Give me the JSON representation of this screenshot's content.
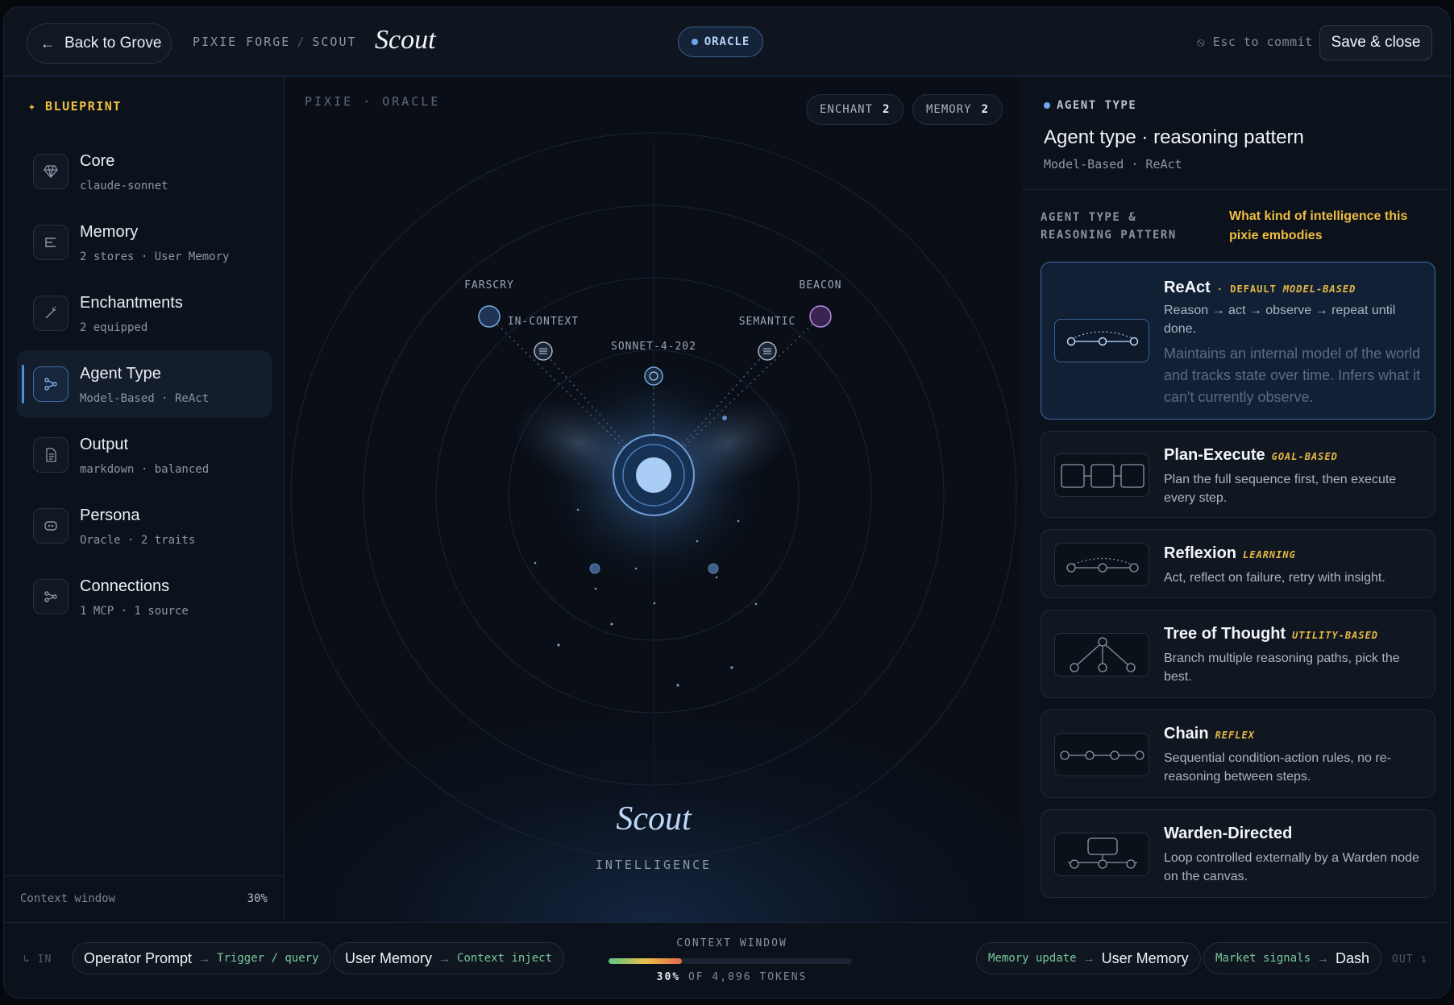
{
  "header": {
    "back_label": "Back to Grove",
    "crumb_1": "PIXIE FORGE",
    "crumb_sep": "/",
    "crumb_2": "SCOUT",
    "title": "Scout",
    "mode_pill": "ORACLE",
    "esc_hint": "⦸ Esc to commit",
    "save_label": "Save & close"
  },
  "sidebar": {
    "heading": "✦ BLUEPRINT",
    "items": [
      {
        "title": "Core",
        "sub": "claude-sonnet",
        "icon": "gem-icon"
      },
      {
        "title": "Memory",
        "sub": "2 stores · User Memory",
        "icon": "memory-icon"
      },
      {
        "title": "Enchantments",
        "sub": "2 equipped",
        "icon": "wand-icon"
      },
      {
        "title": "Agent Type",
        "sub": "Model-Based · ReAct",
        "icon": "branch-icon",
        "active": true
      },
      {
        "title": "Output",
        "sub": "markdown · balanced",
        "icon": "document-icon"
      },
      {
        "title": "Persona",
        "sub": "Oracle · 2 traits",
        "icon": "mask-icon"
      },
      {
        "title": "Connections",
        "sub": "1 MCP · 1 source",
        "icon": "connections-icon"
      }
    ],
    "context_label": "Context window",
    "context_value": "30%"
  },
  "canvas": {
    "label": "PIXIE · ORACLE",
    "enchant_label": "ENCHANT",
    "enchant_count": "2",
    "memory_label": "MEMORY",
    "memory_count": "2",
    "nodes": {
      "farscry": "FARSCRY",
      "beacon": "BEACON",
      "in_context": "IN-CONTEXT",
      "semantic": "SEMANTIC",
      "model": "SONNET-4-202"
    },
    "center_name": "Scout",
    "center_sub": "INTELLIGENCE"
  },
  "panel": {
    "heading": "AGENT TYPE",
    "title": "Agent type · reasoning pattern",
    "subtitle": "Model-Based · ReAct",
    "section_label": "AGENT TYPE & REASONING PATTERN",
    "section_note": "What kind of intelligence this pixie embodies",
    "cards": [
      {
        "name": "ReAct",
        "tag_default": "· DEFAULT",
        "tag": "MODEL-BASED",
        "desc": "Reason → act → observe → repeat until done.",
        "desc2": "Maintains an internal model of the world and tracks state over time. Infers what it can't currently observe."
      },
      {
        "name": "Plan-Execute",
        "tag": "GOAL-BASED",
        "desc": "Plan the full sequence first, then execute every step."
      },
      {
        "name": "Reflexion",
        "tag": "LEARNING",
        "desc": "Act, reflect on failure, retry with insight."
      },
      {
        "name": "Tree of Thought",
        "tag": "UTILITY-BASED",
        "desc": "Branch multiple reasoning paths, pick the best."
      },
      {
        "name": "Chain",
        "tag": "REFLEX",
        "desc": "Sequential condition-action rules, no re-reasoning between steps."
      },
      {
        "name": "Warden-Directed",
        "tag": "",
        "desc": "Loop controlled externally by a Warden node on the canvas."
      }
    ]
  },
  "bottom": {
    "in_label": "↳ IN",
    "out_label": "OUT ↴",
    "inputs": [
      {
        "name": "Operator Prompt",
        "target": "Trigger / query"
      },
      {
        "name": "User Memory",
        "target": "Context inject"
      }
    ],
    "outputs": [
      {
        "source": "Memory update",
        "name": "User Memory"
      },
      {
        "source": "Market signals",
        "name": "Dash"
      }
    ],
    "context_label": "CONTEXT WINDOW",
    "context_percent": "30%",
    "context_fraction": 0.3,
    "context_rest": "OF 4,096 TOKENS"
  }
}
